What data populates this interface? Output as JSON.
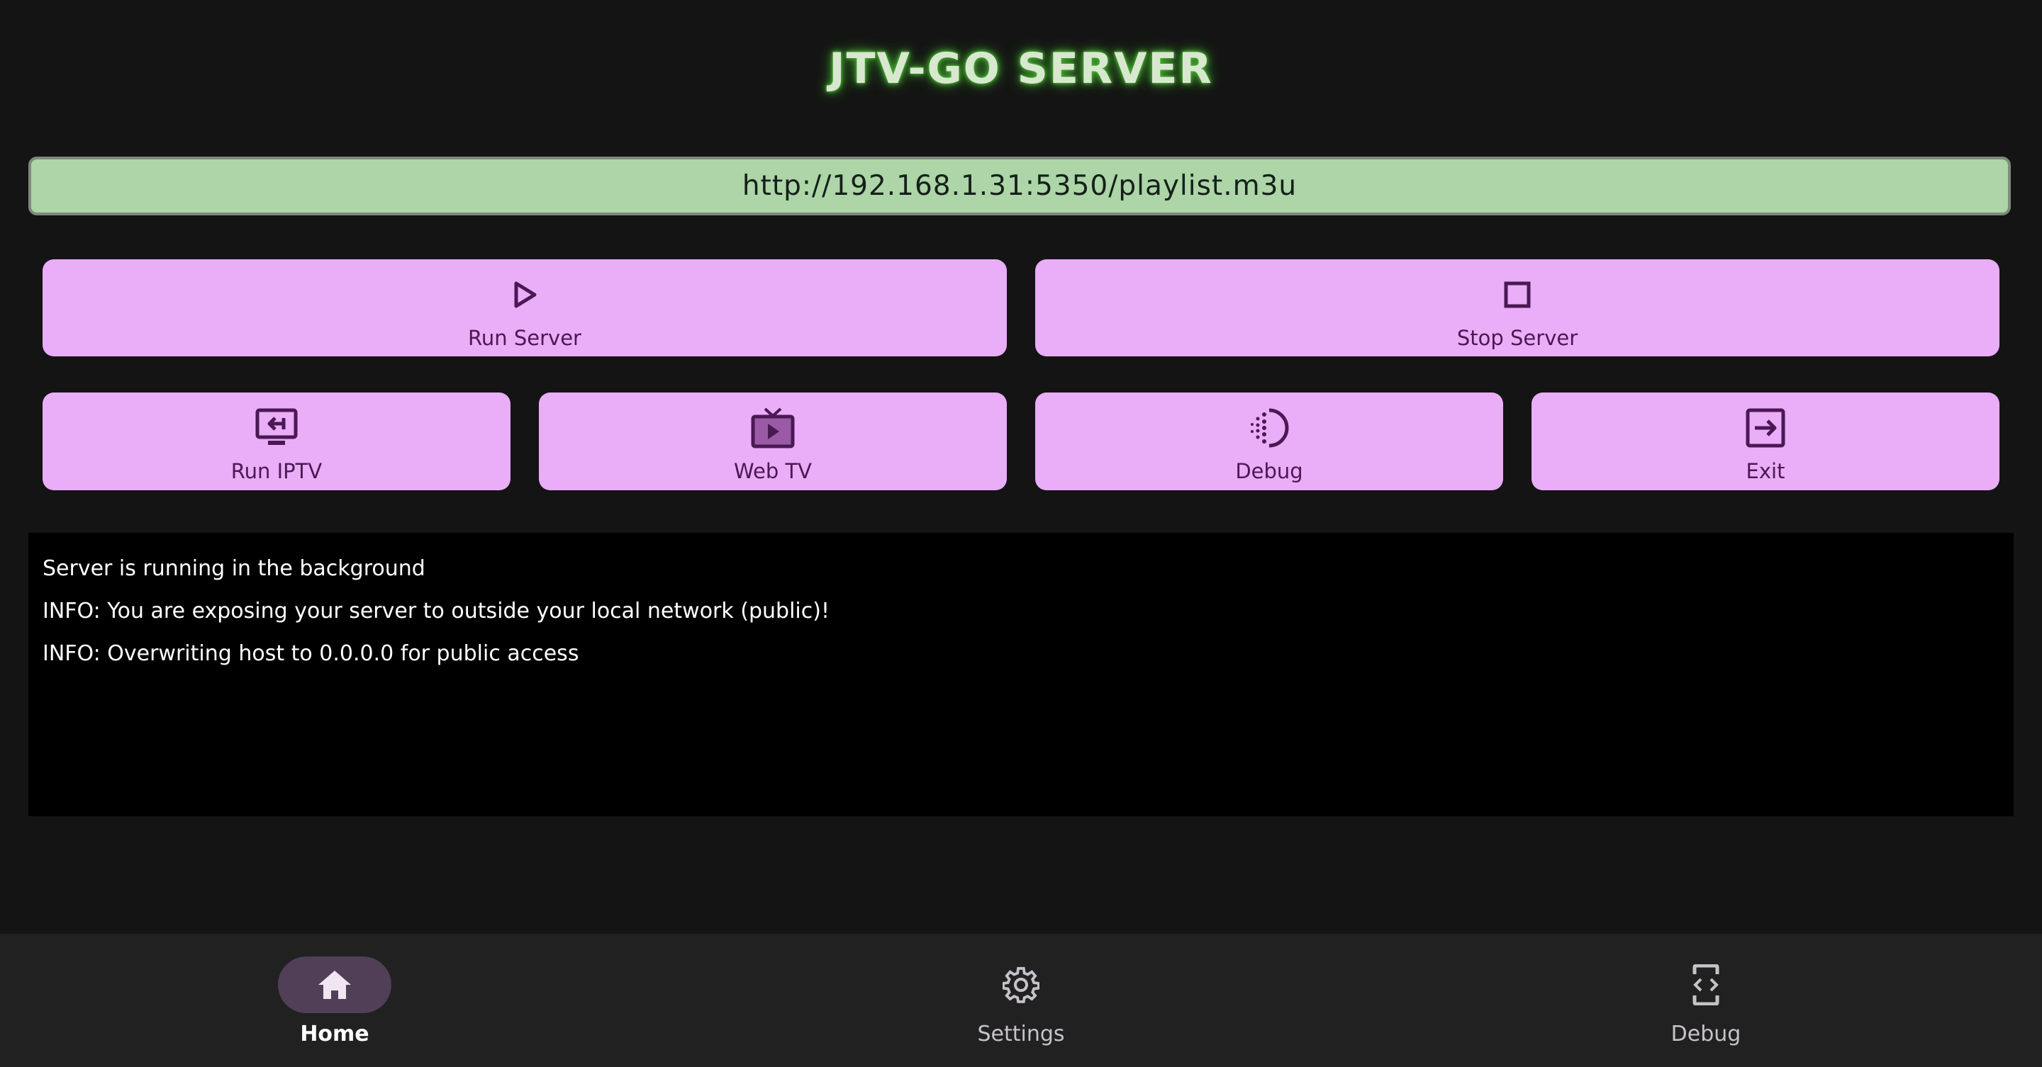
{
  "header": {
    "title": "JTV-GO SERVER"
  },
  "server_url": "http://192.168.1.31:5350/playlist.m3u",
  "actions": {
    "run_server": "Run Server",
    "stop_server": "Stop Server",
    "run_iptv": "Run IPTV",
    "web_tv": "Web TV",
    "debug": "Debug",
    "exit": "Exit"
  },
  "console": {
    "lines": [
      "Server is running in the background",
      "INFO: You are exposing your server to outside your local network (public)!",
      "INFO: Overwriting host to 0.0.0.0 for public access"
    ]
  },
  "bottom_nav": {
    "items": [
      {
        "label": "Home",
        "icon": "home-icon",
        "active": true
      },
      {
        "label": "Settings",
        "icon": "gear-icon",
        "active": false
      },
      {
        "label": "Debug",
        "icon": "developer-mode-icon",
        "active": false
      }
    ]
  },
  "colors": {
    "background": "#141414",
    "title_glow": "#4bb233",
    "url_bar": "#add5a8",
    "button": "#eaadf7",
    "button_text": "#4a1954",
    "console_bg": "#000000",
    "navbar": "#212121",
    "nav_active_pill": "#503f56"
  }
}
